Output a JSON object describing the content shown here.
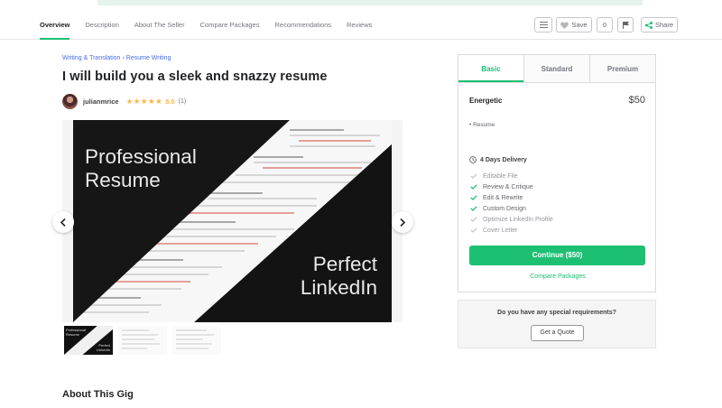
{
  "nav": {
    "tabs": [
      "Overview",
      "Description",
      "About The Seller",
      "Compare Packages",
      "Recommendations",
      "Reviews"
    ],
    "active_tab": "Overview",
    "save_label": "Save",
    "save_count": "0",
    "share_label": "Share",
    "icons": {
      "menu": "list-icon",
      "save": "heart-icon",
      "flag": "flag-icon",
      "share": "share-icon"
    }
  },
  "breadcrumb": {
    "category": "Writing & Translation",
    "separator": "›",
    "subcategory": "Resume Writing"
  },
  "gig": {
    "title": "I will build you a sleek and snazzy resume"
  },
  "seller": {
    "name": "julianmrice",
    "rating": "5.0",
    "reviews": "(1)"
  },
  "gallery": {
    "slide_text_1_line1": "Professional",
    "slide_text_1_line2": "Resume",
    "slide_text_2_line1": "Perfect",
    "slide_text_2_line2": "LinkedIn",
    "thumb_text_1_line1": "Professional",
    "thumb_text_1_line2": "Resume",
    "thumb_text_2_line1": "Perfect",
    "thumb_text_2_line2": "LinkedIn"
  },
  "about": {
    "title": "About This Gig"
  },
  "package": {
    "tabs": [
      "Basic",
      "Standard",
      "Premium"
    ],
    "active_tab": "Basic",
    "name": "Energetic",
    "price": "$50",
    "description": "• Resume",
    "delivery": "4 Days Delivery",
    "features": [
      {
        "label": "Editable File",
        "included": false
      },
      {
        "label": "Review & Critique",
        "included": true
      },
      {
        "label": "Edit & Rewrite",
        "included": true
      },
      {
        "label": "Custom Design",
        "included": true
      },
      {
        "label": "Optimize LinkedIn Profile",
        "included": false
      },
      {
        "label": "Cover Letter",
        "included": false
      }
    ],
    "continue_label": "Continue ($50)",
    "compare_label": "Compare Packages"
  },
  "quote": {
    "question": "Do you have any special requirements?",
    "button_label": "Get a Quote"
  },
  "colors": {
    "accent": "#1dbf73",
    "link": "#446ee7",
    "star": "#ffb33e"
  }
}
